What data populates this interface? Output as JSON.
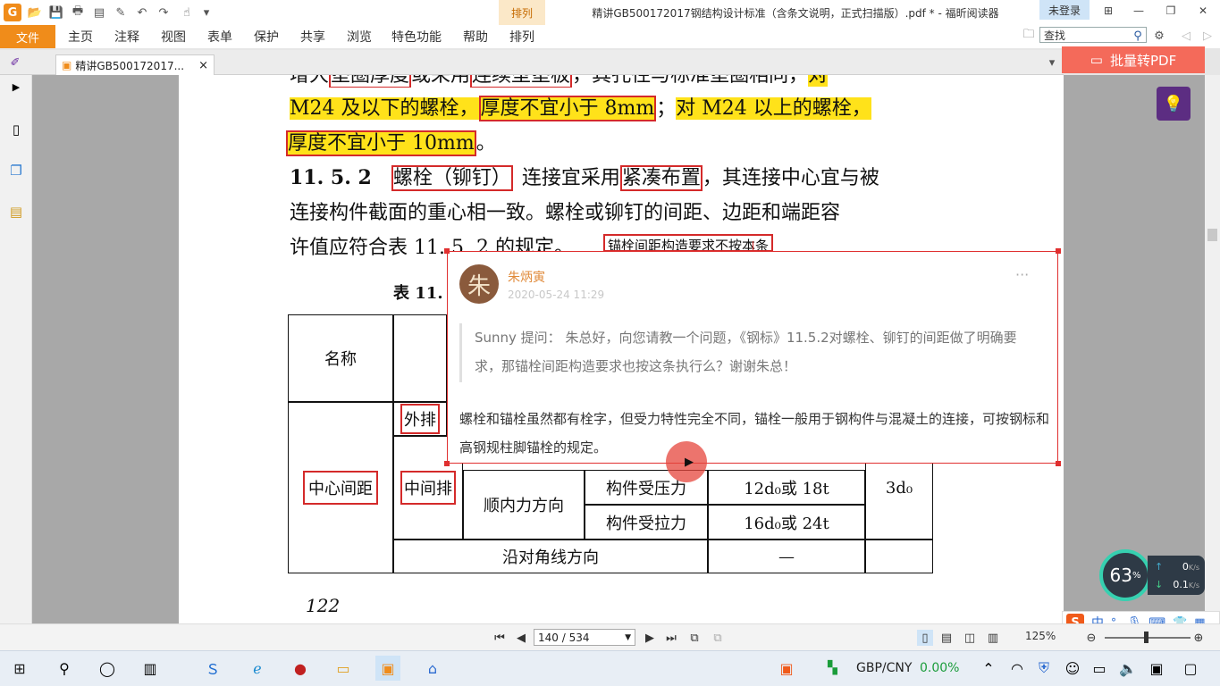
{
  "app": {
    "badge": "G",
    "context_tab": "排列",
    "window_title": "精讲GB500172017钢结构设计标准（含条文说明，正式扫描版）.pdf * - 福昕阅读器",
    "login_label": "未登录",
    "search_placeholder": "查找"
  },
  "menu": {
    "file": "文件",
    "items": [
      "主页",
      "注释",
      "视图",
      "表单",
      "保护",
      "共享",
      "浏览",
      "特色功能",
      "帮助",
      "排列"
    ]
  },
  "tab": {
    "label": "精讲GB500172017...",
    "close": "×"
  },
  "convert_button": "批量转PDF",
  "doc": {
    "line1_pre": "增大",
    "line1_b1": "垫圈厚度",
    "line1_mid": "或采用",
    "line1_b2": "连续型垫板",
    "line1_post": "，其孔径与标准垫圈相同，",
    "line1_hl": "对",
    "line2_a": "M24 及以下的螺栓，",
    "line2_b": "厚度不宜小于 8mm",
    "line2_c": "；",
    "line2_d": "对 M24 以上的螺栓，",
    "line3_a": "厚度不宜小于 10mm",
    "line3_b": "。",
    "line4_num": "11. 5. 2",
    "line4_b1": "螺栓（铆钉）",
    "line4_mid": "连接宜采用",
    "line4_b2": "紧凑布置",
    "line4_post": "，其连接中心宜与被",
    "line5": "连接构件截面的重心相一致。螺栓或铆钉的间距、边距和端距容",
    "line6": "许值应符合表 11. 5. 2 的规定。",
    "callout": "锚栓间距构造要求不按本条",
    "table_caption": "表 11.",
    "page_number": "122"
  },
  "table": {
    "name_header": "名称",
    "center_spacing": "中心间距",
    "outer_row": "外排",
    "middle_row": "中间排",
    "force_direction": "顺内力方向",
    "compression": "构件受压力",
    "tension": "构件受拉力",
    "compression_value": "12d₀或 18t",
    "tension_value": "16d₀或 24t",
    "min_value": "3d₀",
    "diagonal": "沿对角线方向",
    "diagonal_value": "—"
  },
  "comment": {
    "avatar_char": "朱",
    "author": "朱炳寅",
    "date": "2020-05-24 11:29",
    "more": "···",
    "question": "Sunny 提问： 朱总好，向您请教一个问题，《钢标》11.5.2对螺栓、铆钉的间距做了明确要求，那锚栓间距构造要求也按这条执行么？谢谢朱总！",
    "answer": "螺栓和锚栓虽然都有栓字，但受力特性完全不同，锚栓一般用于钢构件与混凝土的连接，可按钢标和高钢规柱脚锚栓的规定。"
  },
  "statusbar": {
    "page_input": "140 / 534",
    "zoom": "125%"
  },
  "overlay": {
    "cpu_percent": "63",
    "cpu_unit": "%",
    "up_speed": "0",
    "down_speed": "0.1",
    "speed_unit": "K/s",
    "ime_lang": "中"
  },
  "taskbar": {
    "currency_pair": "GBP/CNY",
    "currency_change": "0.00%",
    "currency_color": "#1a9c3a"
  },
  "colors": {
    "accent": "#f08c1a",
    "highlight": "#ffe21a",
    "annotation_red": "#d42a2a",
    "convert_btn": "#f46a5a"
  }
}
